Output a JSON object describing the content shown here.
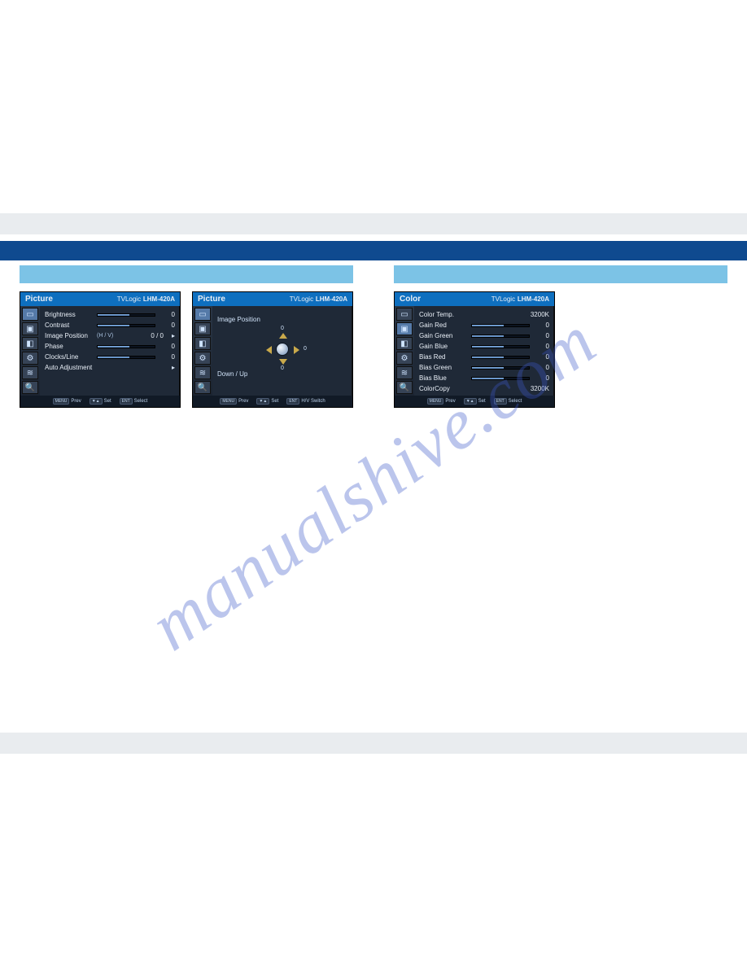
{
  "watermark": "manualshive.com",
  "brand": "TVLogic",
  "model": "LHM-420A",
  "osd_footer": {
    "menu_key": "MENU",
    "menu_lbl": "Prev",
    "va_key": "▼▲",
    "va_lbl": "Set",
    "ent_key": "ENT",
    "ent_lbl": "Select",
    "ent_lbl_hv": "H/V Switch"
  },
  "picture_panel": {
    "title": "Picture",
    "items": [
      {
        "label": "Brightness",
        "value": "0"
      },
      {
        "label": "Contrast",
        "value": "0"
      },
      {
        "label": "Image Position",
        "hv": "(H / V)",
        "value": "0 / 0",
        "arrow": "▸"
      },
      {
        "label": "Phase",
        "value": "0"
      },
      {
        "label": "Clocks/Line",
        "value": "0"
      },
      {
        "label": "Auto Adjustment",
        "arrow": "▸"
      }
    ]
  },
  "image_position_panel": {
    "title": "Picture",
    "heading": "Image Position",
    "sub": "Down / Up",
    "up": "0",
    "down": "0",
    "left": "0",
    "right": "0"
  },
  "color_panel": {
    "title": "Color",
    "items": [
      {
        "label": "Color Temp.",
        "value": "3200K",
        "preset": true
      },
      {
        "label": "Gain Red",
        "value": "0"
      },
      {
        "label": "Gain Green",
        "value": "0"
      },
      {
        "label": "Gain Blue",
        "value": "0"
      },
      {
        "label": "Bias Red",
        "value": "0"
      },
      {
        "label": "Bias Green",
        "value": "0"
      },
      {
        "label": "Bias Blue",
        "value": "0"
      },
      {
        "label": "ColorCopy",
        "value": "3200K",
        "preset": true
      }
    ]
  },
  "sidebar_icons": [
    "▭",
    "▣",
    "◧",
    "⚙",
    "≋",
    "🔍"
  ]
}
